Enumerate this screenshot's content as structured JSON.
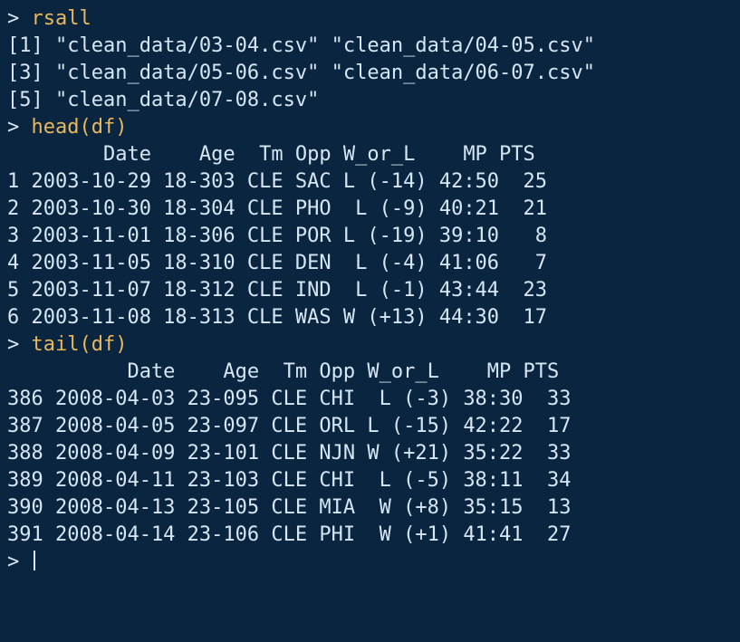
{
  "prompt_symbol": ">",
  "lines": [
    {
      "kind": "cmd",
      "cmd": "rsall"
    },
    {
      "kind": "out",
      "text": "[1] \"clean_data/03-04.csv\" \"clean_data/04-05.csv\""
    },
    {
      "kind": "out",
      "text": "[3] \"clean_data/05-06.csv\" \"clean_data/06-07.csv\""
    },
    {
      "kind": "out",
      "text": "[5] \"clean_data/07-08.csv\""
    },
    {
      "kind": "cmd",
      "cmd": "head(df)"
    },
    {
      "kind": "out",
      "text": "        Date    Age  Tm Opp W_or_L    MP PTS"
    },
    {
      "kind": "out",
      "text": "1 2003-10-29 18-303 CLE SAC L (-14) 42:50  25"
    },
    {
      "kind": "out",
      "text": "2 2003-10-30 18-304 CLE PHO  L (-9) 40:21  21"
    },
    {
      "kind": "out",
      "text": "3 2003-11-01 18-306 CLE POR L (-19) 39:10   8"
    },
    {
      "kind": "out",
      "text": "4 2003-11-05 18-310 CLE DEN  L (-4) 41:06   7"
    },
    {
      "kind": "out",
      "text": "5 2003-11-07 18-312 CLE IND  L (-1) 43:44  23"
    },
    {
      "kind": "out",
      "text": "6 2003-11-08 18-313 CLE WAS W (+13) 44:30  17"
    },
    {
      "kind": "cmd",
      "cmd": "tail(df)"
    },
    {
      "kind": "out",
      "text": "          Date    Age  Tm Opp W_or_L    MP PTS"
    },
    {
      "kind": "out",
      "text": "386 2008-04-03 23-095 CLE CHI  L (-3) 38:30  33"
    },
    {
      "kind": "out",
      "text": "387 2008-04-05 23-097 CLE ORL L (-15) 42:22  17"
    },
    {
      "kind": "out",
      "text": "388 2008-04-09 23-101 CLE NJN W (+21) 35:22  33"
    },
    {
      "kind": "out",
      "text": "389 2008-04-11 23-103 CLE CHI  L (-5) 38:11  34"
    },
    {
      "kind": "out",
      "text": "390 2008-04-13 23-105 CLE MIA  W (+8) 35:15  13"
    },
    {
      "kind": "out",
      "text": "391 2008-04-14 23-106 CLE PHI  W (+1) 41:41  27"
    },
    {
      "kind": "prompt_only"
    }
  ],
  "rsall_output": {
    "index_start": 1,
    "files": [
      "clean_data/03-04.csv",
      "clean_data/04-05.csv",
      "clean_data/05-06.csv",
      "clean_data/06-07.csv",
      "clean_data/07-08.csv"
    ]
  },
  "head_df": {
    "columns": [
      "Date",
      "Age",
      "Tm",
      "Opp",
      "W_or_L",
      "MP",
      "PTS"
    ],
    "rows": [
      {
        "n": 1,
        "Date": "2003-10-29",
        "Age": "18-303",
        "Tm": "CLE",
        "Opp": "SAC",
        "W_or_L": "L (-14)",
        "MP": "42:50",
        "PTS": 25
      },
      {
        "n": 2,
        "Date": "2003-10-30",
        "Age": "18-304",
        "Tm": "CLE",
        "Opp": "PHO",
        "W_or_L": "L (-9)",
        "MP": "40:21",
        "PTS": 21
      },
      {
        "n": 3,
        "Date": "2003-11-01",
        "Age": "18-306",
        "Tm": "CLE",
        "Opp": "POR",
        "W_or_L": "L (-19)",
        "MP": "39:10",
        "PTS": 8
      },
      {
        "n": 4,
        "Date": "2003-11-05",
        "Age": "18-310",
        "Tm": "CLE",
        "Opp": "DEN",
        "W_or_L": "L (-4)",
        "MP": "41:06",
        "PTS": 7
      },
      {
        "n": 5,
        "Date": "2003-11-07",
        "Age": "18-312",
        "Tm": "CLE",
        "Opp": "IND",
        "W_or_L": "L (-1)",
        "MP": "43:44",
        "PTS": 23
      },
      {
        "n": 6,
        "Date": "2003-11-08",
        "Age": "18-313",
        "Tm": "CLE",
        "Opp": "WAS",
        "W_or_L": "W (+13)",
        "MP": "44:30",
        "PTS": 17
      }
    ]
  },
  "tail_df": {
    "columns": [
      "Date",
      "Age",
      "Tm",
      "Opp",
      "W_or_L",
      "MP",
      "PTS"
    ],
    "rows": [
      {
        "n": 386,
        "Date": "2008-04-03",
        "Age": "23-095",
        "Tm": "CLE",
        "Opp": "CHI",
        "W_or_L": "L (-3)",
        "MP": "38:30",
        "PTS": 33
      },
      {
        "n": 387,
        "Date": "2008-04-05",
        "Age": "23-097",
        "Tm": "CLE",
        "Opp": "ORL",
        "W_or_L": "L (-15)",
        "MP": "42:22",
        "PTS": 17
      },
      {
        "n": 388,
        "Date": "2008-04-09",
        "Age": "23-101",
        "Tm": "CLE",
        "Opp": "NJN",
        "W_or_L": "W (+21)",
        "MP": "35:22",
        "PTS": 33
      },
      {
        "n": 389,
        "Date": "2008-04-11",
        "Age": "23-103",
        "Tm": "CLE",
        "Opp": "CHI",
        "W_or_L": "L (-5)",
        "MP": "38:11",
        "PTS": 34
      },
      {
        "n": 390,
        "Date": "2008-04-13",
        "Age": "23-105",
        "Tm": "CLE",
        "Opp": "MIA",
        "W_or_L": "W (+8)",
        "MP": "35:15",
        "PTS": 13
      },
      {
        "n": 391,
        "Date": "2008-04-14",
        "Age": "23-106",
        "Tm": "CLE",
        "Opp": "PHI",
        "W_or_L": "W (+1)",
        "MP": "41:41",
        "PTS": 27
      }
    ]
  }
}
